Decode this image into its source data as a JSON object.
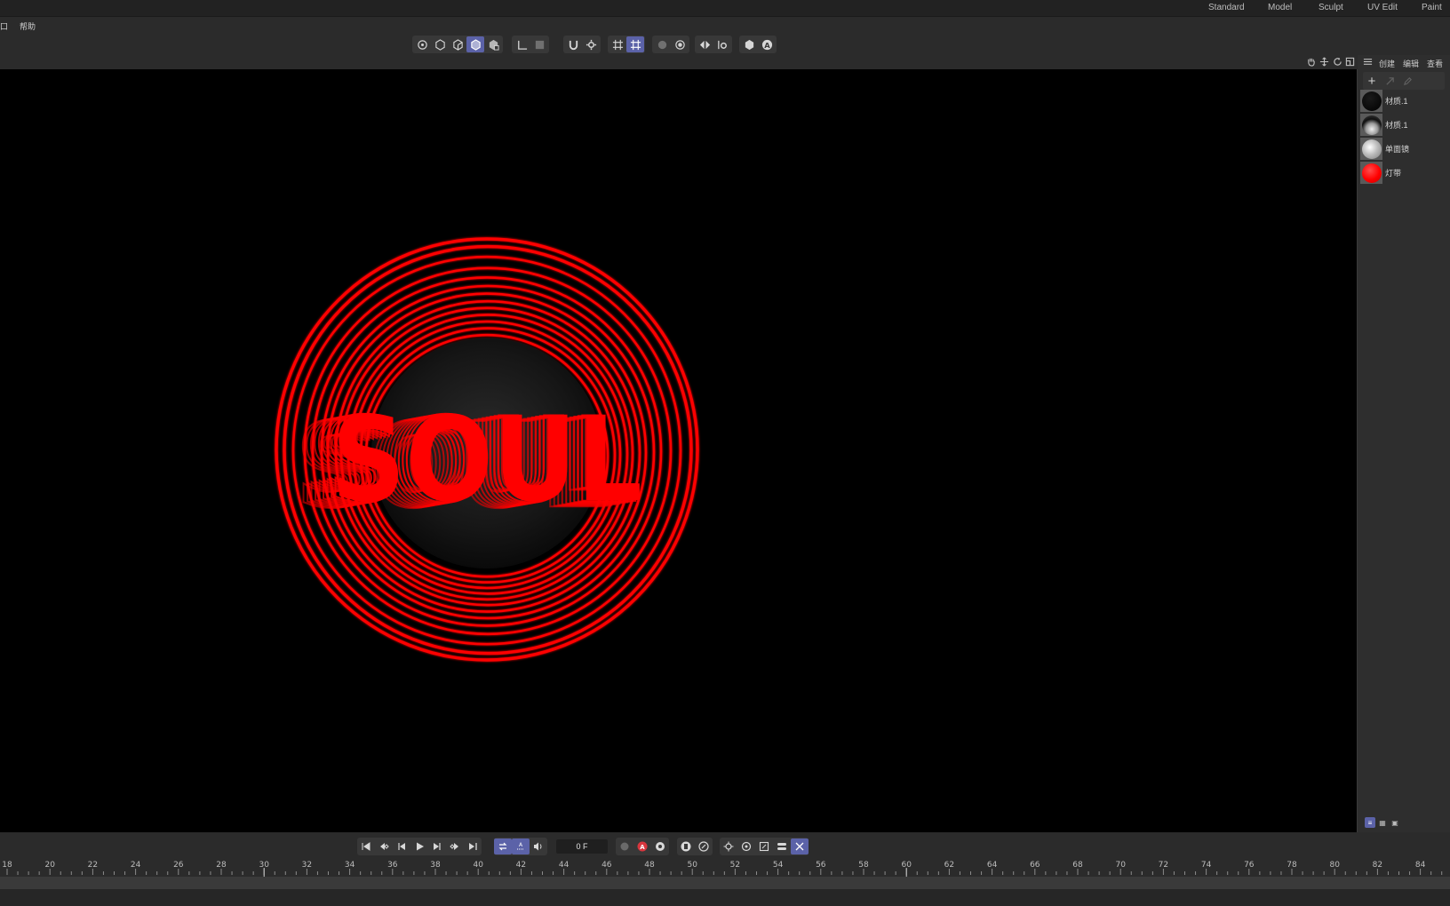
{
  "layouts": {
    "tabs": [
      {
        "label": "Standard"
      },
      {
        "label": "Model"
      },
      {
        "label": "Sculpt"
      },
      {
        "label": "UV Edit"
      },
      {
        "label": "Paint"
      }
    ]
  },
  "menu": {
    "items": [
      {
        "label": "窗口"
      },
      {
        "label": "帮助"
      }
    ]
  },
  "toolbar": {
    "groups": [
      {
        "icons": [
          "model-mode-icon",
          "point-mode-icon",
          "edge-mode-icon",
          "polygon-mode-icon",
          "uv-mode-icon"
        ],
        "active": 3
      },
      {
        "icons": [
          "axis-icon",
          "solo-icon"
        ]
      },
      {
        "icons": [
          "magnet-snap-icon",
          "snap-settings-icon"
        ]
      },
      {
        "icons": [
          "workplane-icon",
          "grid-snap-icon"
        ],
        "active": 1
      },
      {
        "icons": [
          "render-region-icon",
          "render-view-icon"
        ]
      },
      {
        "icons": [
          "symmetry-icon",
          "symmetry-settings-icon"
        ]
      },
      {
        "icons": [
          "lock-icon",
          "auto-icon"
        ]
      }
    ]
  },
  "viewport": {
    "background": "#000000",
    "text_3d": "SOUL",
    "accent": "#ff0000"
  },
  "materials": {
    "header_tabs": [
      {
        "label": "创建"
      },
      {
        "label": "编辑"
      },
      {
        "label": "查看"
      }
    ],
    "items": [
      {
        "name": "材质.1",
        "color": "#050505"
      },
      {
        "name": "材质.1",
        "color": "#cfcfcf"
      },
      {
        "name": "单面镜",
        "color": "#b9b9b9"
      },
      {
        "name": "灯带",
        "color": "#ff1a1a"
      }
    ]
  },
  "playback": {
    "frame": "0 F"
  },
  "timeline": {
    "ticks": [
      18,
      20,
      22,
      24,
      26,
      28,
      30,
      32,
      34,
      36,
      38,
      40,
      42,
      44,
      46,
      48,
      50,
      52,
      54,
      56,
      58,
      60,
      62,
      64,
      66,
      68,
      70,
      72,
      74,
      76,
      78,
      80,
      82,
      84
    ]
  }
}
